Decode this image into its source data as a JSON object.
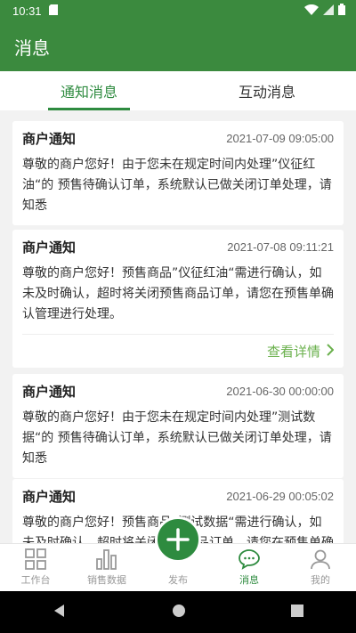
{
  "status_bar": {
    "time": "10:31"
  },
  "app_bar": {
    "title": "消息"
  },
  "tabs": [
    {
      "label": "通知消息",
      "active": true
    },
    {
      "label": "互动消息",
      "active": false
    }
  ],
  "messages": [
    {
      "title": "商户通知",
      "time": "2021-07-09 09:05:00",
      "body": "尊敬的商户您好！由于您未在规定时间内处理”仪征红油“的 预售待确认订单，系统默认已做关闭订单处理，请知悉"
    },
    {
      "title": "商户通知",
      "time": "2021-07-08 09:11:21",
      "body": "尊敬的商户您好！预售商品”仪征红油“需进行确认，如未及时确认，超时将关闭预售商品订单，请您在预售单确认管理进行处理。",
      "link": "查看详情"
    },
    {
      "title": "商户通知",
      "time": "2021-06-30 00:00:00",
      "body": "尊敬的商户您好！由于您未在规定时间内处理”测试数据“的 预售待确认订单，系统默认已做关闭订单处理，请知悉"
    },
    {
      "title": "商户通知",
      "time": "2021-06-29 00:05:02",
      "body": "尊敬的商户您好！预售商品”测试数据“需进行确认，如未及时确认，超时将关闭预售商品订单，请您在预售单确认管理进行处理。"
    }
  ],
  "bottom_nav": [
    {
      "label": "工作台",
      "icon": "grid-icon"
    },
    {
      "label": "销售数据",
      "icon": "bar-chart-icon"
    },
    {
      "label": "发布",
      "icon": "plus-icon"
    },
    {
      "label": "消息",
      "icon": "chat-icon",
      "active": true
    },
    {
      "label": "我的",
      "icon": "user-icon"
    }
  ],
  "colors": {
    "primary": "#3b8a3e",
    "accent": "#2e8b3f",
    "link": "#6ab04c"
  }
}
